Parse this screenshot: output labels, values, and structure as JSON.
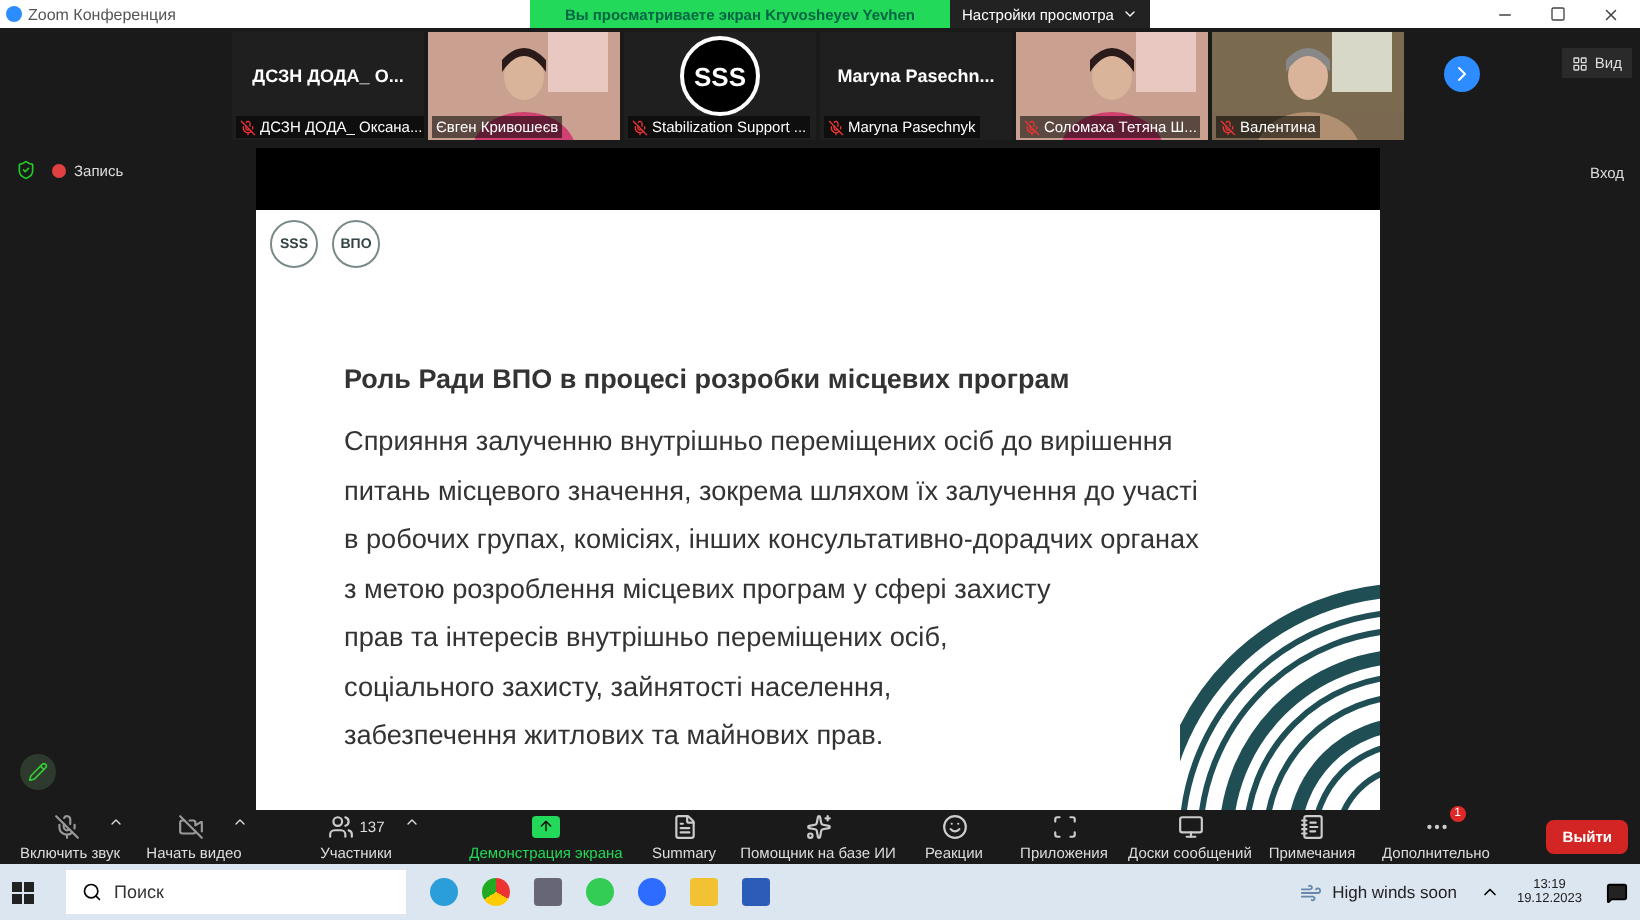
{
  "title_bar": {
    "app": "Zoom Конференция",
    "banner": "Вы просматриваете экран Kryvosheyev Yevhen",
    "view_options": "Настройки просмотра"
  },
  "participants": [
    {
      "kind": "name",
      "tile_label": "ДСЗН ДОДА_ О...",
      "name": "ДСЗН ДОДА_ Оксана...",
      "muted": true
    },
    {
      "kind": "video",
      "name": "Євген Кривошеєв",
      "muted": false
    },
    {
      "kind": "logo",
      "logo_text": "SSS",
      "name": "Stabilization Support ...",
      "muted": true
    },
    {
      "kind": "name",
      "tile_label": "Maryna  Pasechn...",
      "name": "Maryna Pasechnyk",
      "muted": true
    },
    {
      "kind": "video",
      "name": "Соломаха Тетяна Ш...",
      "muted": true
    },
    {
      "kind": "video",
      "name": "Валентина",
      "muted": true
    }
  ],
  "view_button": "Вид",
  "recording": "Запись",
  "enter_button": "Вход",
  "slide": {
    "logos": [
      "SSS",
      "ВПО"
    ],
    "title": "Роль Ради ВПО в процесі розробки місцевих програм",
    "body": "Сприяння залученню внутрішньо переміщених осіб до вирішення\nпитань місцевого значення, зокрема шляхом їх залучення до участі\nв робочих групах, комісіях, інших консультативно-дорадчих органах\nз метою розроблення місцевих програм у сфері захисту\nправ та інтересів внутрішньо переміщених осіб,\nсоціального захисту, зайнятості населення,\nзабезпечення житлових та майнових прав."
  },
  "toolbar": {
    "items": [
      {
        "kind": "audio",
        "label": "Включить звук",
        "off": true,
        "caret": true
      },
      {
        "kind": "video",
        "label": "Начать видео",
        "off": true,
        "caret": true
      },
      {
        "kind": "participants",
        "label": "Участники",
        "count": "137",
        "caret": true
      },
      {
        "kind": "share",
        "label": "Демонстрация экрана"
      },
      {
        "kind": "summary",
        "label": "Summary"
      },
      {
        "kind": "assistant",
        "label": "Помощник на базе ИИ"
      },
      {
        "kind": "reactions",
        "label": "Реакции"
      },
      {
        "kind": "apps",
        "label": "Приложения"
      },
      {
        "kind": "boards",
        "label": "Доски сообщений"
      },
      {
        "kind": "notes",
        "label": "Примечания"
      },
      {
        "kind": "more",
        "label": "Дополнительно",
        "badge": "1"
      }
    ],
    "exit_button": "Выйти"
  },
  "taskbar": {
    "search_placeholder": "Поиск",
    "weather": "High winds soon",
    "time": "13:19",
    "date": "19.12.2023"
  }
}
